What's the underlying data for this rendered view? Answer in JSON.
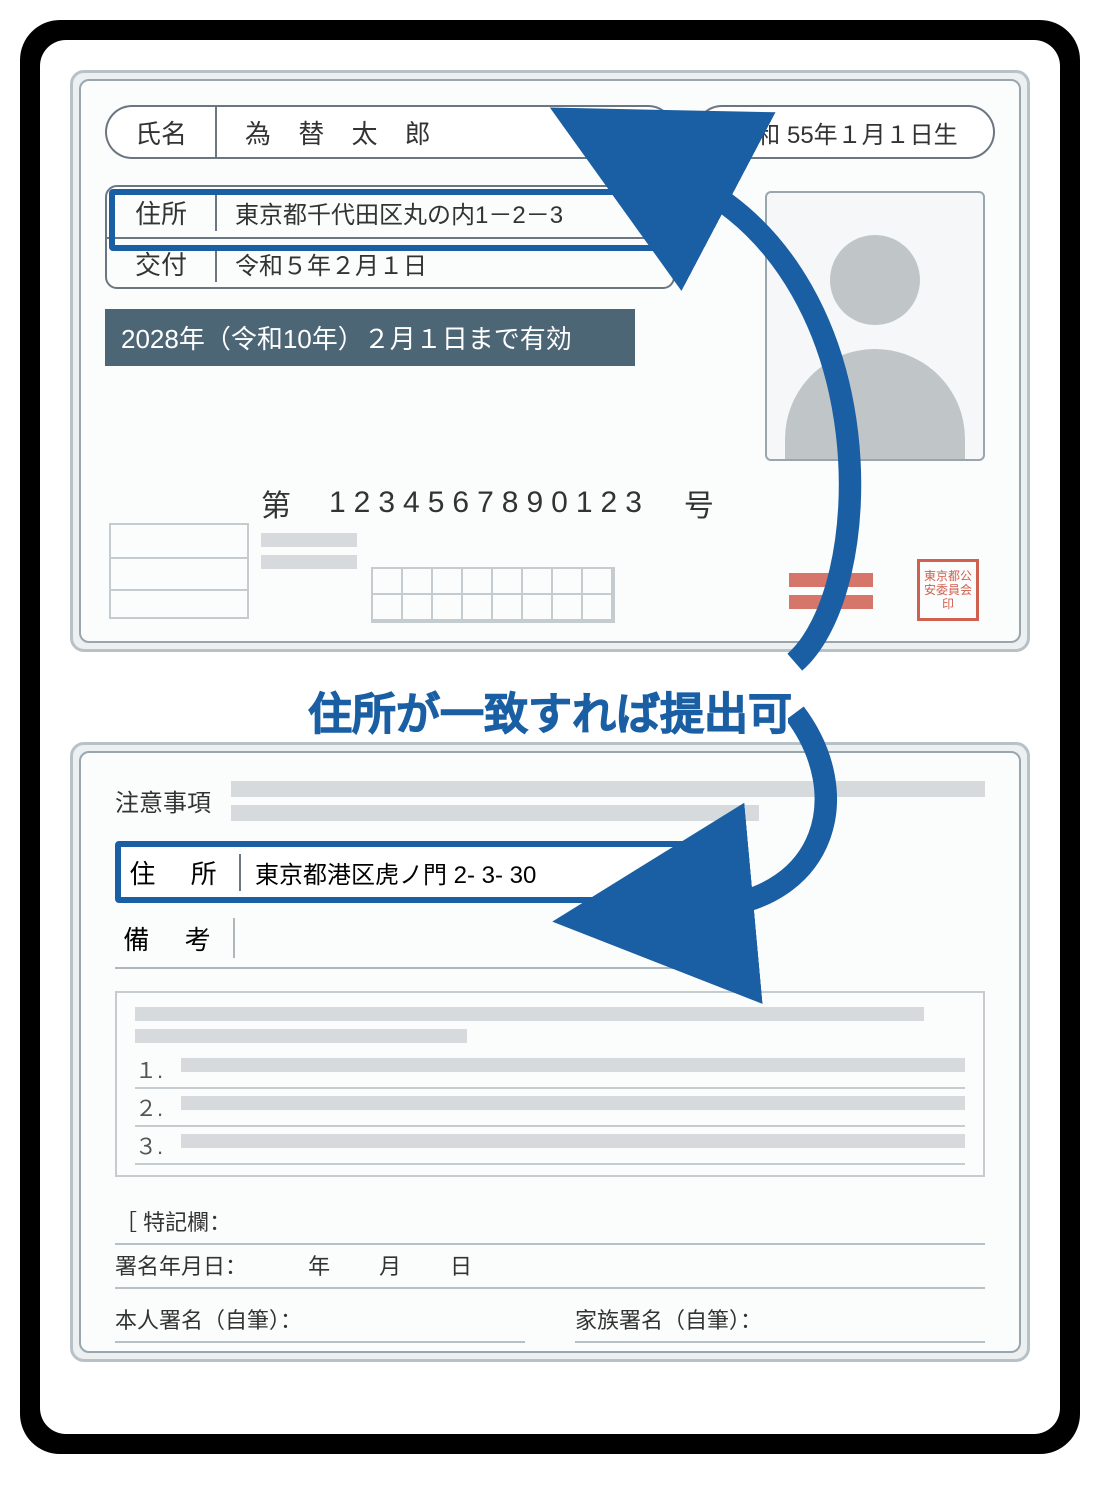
{
  "front": {
    "name_label": "氏名",
    "name_value": "為 替 太 郎",
    "dob": "昭和 55年１月１日生",
    "address_label": "住所",
    "address_value": "東京都千代田区丸の内1－2－3",
    "issue_label": "交付",
    "issue_value": "令和５年２月１日",
    "validity": "2028年（令和10年）２月１日まで有効",
    "num_prefix": "第",
    "num_value": "1234567890123",
    "num_suffix": "号",
    "stamp": "東京都公安委員会印"
  },
  "caption": "住所が一致すれば提出可",
  "back": {
    "notes_label": "注意事項",
    "address_label": "住 所",
    "address_value": "東京都港区虎ノ門 2- 3- 30",
    "remarks_label": "備 考",
    "list_1": "１.",
    "list_2": "２.",
    "list_3": "３.",
    "special": "［ 特記欄：",
    "sign_date": "署名年月日：",
    "year": "年",
    "month": "月",
    "day": "日",
    "self_sign": "本人署名（自筆）：",
    "family_sign": "家族署名（自筆）："
  }
}
